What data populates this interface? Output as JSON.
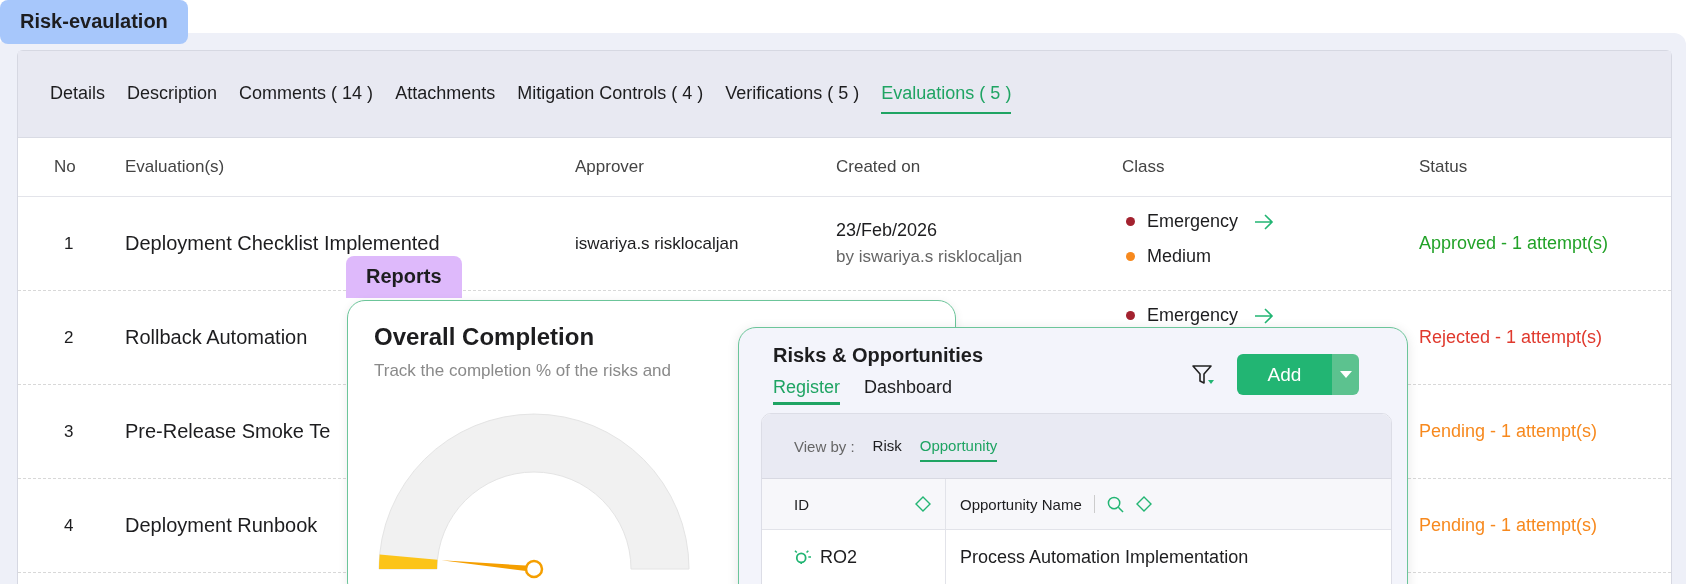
{
  "page_label": "Risk-evaulation",
  "tabs": [
    {
      "label": "Details",
      "selected": false
    },
    {
      "label": "Description",
      "selected": false
    },
    {
      "label": "Comments ( 14 )",
      "selected": false
    },
    {
      "label": "Attachments",
      "selected": false
    },
    {
      "label": "Mitigation Controls ( 4 )",
      "selected": false
    },
    {
      "label": "Verifications ( 5 )",
      "selected": false
    },
    {
      "label": "Evaluations ( 5 )",
      "selected": true
    }
  ],
  "table": {
    "columns": [
      "No",
      "Evaluation(s)",
      "Approver",
      "Created on",
      "Class",
      "Status"
    ],
    "rows": [
      {
        "no": "1",
        "evaluation": "Deployment Checklist Implemented",
        "approver": "iswariya.s risklocaljan",
        "created_date": "23/Feb/2026",
        "created_by": "by iswariya.s risklocaljan",
        "classes": [
          {
            "label": "Emergency",
            "color": "#a3222f",
            "arrow": true
          },
          {
            "label": "Medium",
            "color": "#f7891e"
          }
        ],
        "status": {
          "text": "Approved - 1 attempt(s)",
          "color": "#22a228"
        }
      },
      {
        "no": "2",
        "evaluation": "Rollback Automation",
        "classes": [
          {
            "label": "Emergency",
            "color": "#a3222f",
            "arrow": true
          }
        ],
        "status": {
          "text": "Rejected - 1 attempt(s)",
          "color": "#e0392d"
        }
      },
      {
        "no": "3",
        "evaluation": "Pre-Release Smoke Te",
        "classes": [],
        "status": {
          "text": "Pending - 1 attempt(s)",
          "color": "#f7891e"
        }
      },
      {
        "no": "4",
        "evaluation": "Deployment Runbook",
        "classes": [],
        "status": {
          "text": "Pending - 1 attempt(s)",
          "color": "#f7891e"
        }
      }
    ]
  },
  "reports": {
    "label": "Reports",
    "title": "Overall Completion",
    "subtitle": "Track the completion % of the risks and",
    "gauge": {
      "level": 0.03
    }
  },
  "risks_panel": {
    "title": "Risks & Opportunities",
    "tabs": [
      {
        "label": "Register",
        "selected": true
      },
      {
        "label": "Dashboard",
        "selected": false
      }
    ],
    "add_button": "Add",
    "view_by": {
      "label": "View by :",
      "options": [
        {
          "label": "Risk",
          "selected": false
        },
        {
          "label": "Opportunity",
          "selected": true
        }
      ]
    },
    "columns": [
      "ID",
      "Opportunity Name"
    ],
    "rows": [
      {
        "id": "RO2",
        "name": "Process Automation Implementation"
      }
    ]
  }
}
